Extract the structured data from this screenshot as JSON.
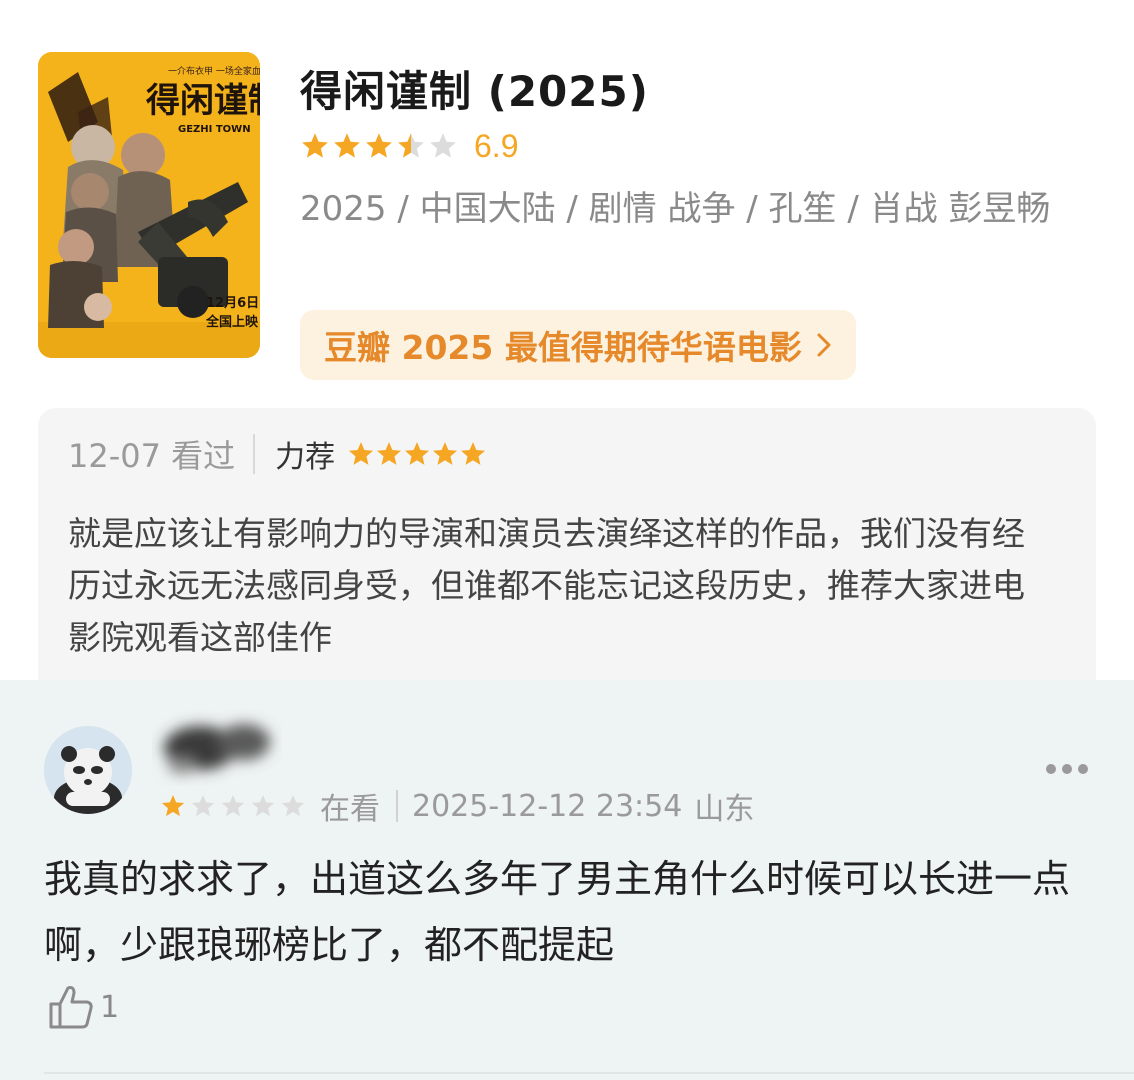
{
  "movie": {
    "title": "得闲谨制 (2025)",
    "rating_value": 6.9,
    "rating_text": "6.9",
    "stars_filled": 3.5,
    "meta": "2025 / 中国大陆 / 剧情 战争 / 孔笙 / 肖战 彭昱畅",
    "ranking_badge": "豆瓣 2025 最值得期待华语电影",
    "poster": {
      "title_cn": "得闲谨制",
      "title_en": "GEZHI TOWN",
      "tagline": "一介布衣甲  一场全家血",
      "release_line1": "12月6日",
      "release_line2": "全国上映"
    }
  },
  "my_review": {
    "date_status": "12-07 看过",
    "recommend_label": "力荐",
    "stars": 5,
    "text": "就是应该让有影响力的导演和演员去演绎这样的作品，我们没有经历过永远无法感同身受，但谁都不能忘记这段历史，推荐大家进电影院观看这部佳作"
  },
  "comment": {
    "stars": 1,
    "status": "在看",
    "timestamp": "2025-12-12 23:54",
    "location": "山东",
    "text": "我真的求求了，出道这么多年了男主角什么时候可以长进一点啊，少跟琅琊榜比了，都不配提起",
    "likes": "1"
  },
  "colors": {
    "star": "#f5a623",
    "star_empty": "#dcdcdc",
    "badge_bg": "#fdf1e0",
    "badge_text": "#e5892a",
    "comment_bg": "#eef3f3",
    "review_bg": "#f5f5f5"
  },
  "icons": [
    "star-icon",
    "chevron-right-icon",
    "more-icon",
    "thumbs-up-icon"
  ]
}
